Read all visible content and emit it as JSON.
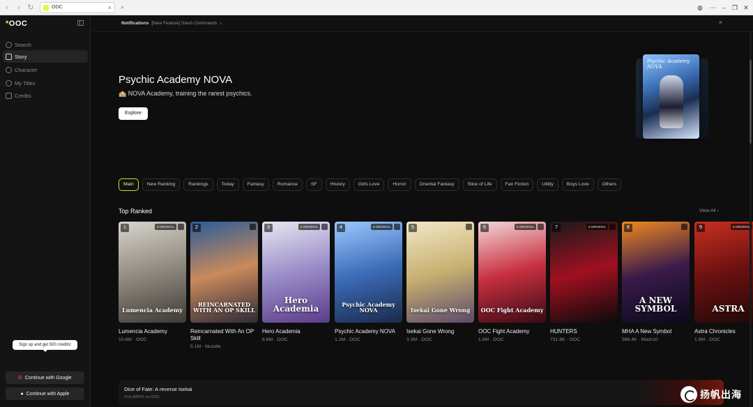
{
  "browser": {
    "tab_title": "OOC",
    "close": "×"
  },
  "sidebar": {
    "logo": "OOC",
    "items": [
      {
        "label": "Search",
        "icon": "search-icon"
      },
      {
        "label": "Story",
        "icon": "book-icon"
      },
      {
        "label": "Character",
        "icon": "character-icon"
      },
      {
        "label": "My Titles",
        "icon": "heart-icon"
      },
      {
        "label": "Credits",
        "icon": "credits-icon"
      }
    ],
    "signup_tip": "Sign up and get 500 credits!",
    "google_btn": "Continue with Google",
    "apple_btn": "Continue with Apple"
  },
  "notification": {
    "label": "Notifications",
    "message": "[New Feature] Slash Commands",
    "chevron": "›",
    "close": "×"
  },
  "hero": {
    "title": "Psychic Academy NOVA",
    "subtitle": "🏫 NOVA Academy, training the rarest psychics.",
    "explore": "Explore",
    "cover_title": "Psychic Academy NOVA"
  },
  "genres": [
    "Main",
    "New Ranking",
    "Rankings",
    "Today",
    "Fantasy",
    "Romance",
    "SF",
    "History",
    "Girls Love",
    "Horror",
    "Oriental Fantasy",
    "Slice of Life",
    "Fan Fiction",
    "Utility",
    "Boys Love",
    "Others"
  ],
  "top_ranked": {
    "title": "Top Ranked",
    "view_all": "View All ›",
    "badge": "ORIGINAL",
    "items": [
      {
        "rank": "1",
        "title": "Lumencia Academy",
        "meta": "10.6M · OOC",
        "cover_text": "Lumencia Academy",
        "original": true,
        "colors": [
          "#d9d4cc",
          "#8f8a80",
          "#3e3a34"
        ]
      },
      {
        "rank": "2",
        "title": "Reincarnated With An OP Skill",
        "meta": "5.1M · Nuzelle",
        "cover_text": "REINCARNATED WITH AN OP SKILL",
        "original": false,
        "colors": [
          "#2a5c9a",
          "#c98a5a",
          "#2e2a3a"
        ]
      },
      {
        "rank": "3",
        "title": "Hero Academia",
        "meta": "8.8M · OOC",
        "cover_text": "Hero Academia",
        "original": true,
        "colors": [
          "#e8e8f2",
          "#9a8cc8",
          "#5a3c8a"
        ]
      },
      {
        "rank": "4",
        "title": "Psychic Academy NOVA",
        "meta": "1.2M · OOC",
        "cover_text": "Psychic Academy NOVA",
        "original": true,
        "colors": [
          "#9dc8ff",
          "#3c6cb8",
          "#1a2a4a"
        ]
      },
      {
        "rank": "5",
        "title": "Isekai Gone Wrong",
        "meta": "3.3M · OOC",
        "cover_text": "Isekai Gone Wrong",
        "original": false,
        "colors": [
          "#f2e8c8",
          "#c8b070",
          "#5a4a6a"
        ]
      },
      {
        "rank": "6",
        "title": "OOC Fight Academy",
        "meta": "1.8M · OOC",
        "cover_text": "OOC Fight Academy",
        "original": true,
        "colors": [
          "#f2d8d8",
          "#c83040",
          "#3a0a14"
        ]
      },
      {
        "rank": "7",
        "title": "HUNTERS",
        "meta": "731.6K · OOC",
        "cover_text": "",
        "original": true,
        "colors": [
          "#1a1a1a",
          "#a01020",
          "#0a0a0a"
        ]
      },
      {
        "rank": "8",
        "title": "MHA A New Symbol",
        "meta": "566.4K · Mash10",
        "cover_text": "A NEW SYMBOL",
        "original": false,
        "colors": [
          "#f08a20",
          "#3a1a4a",
          "#0a0a1a"
        ]
      },
      {
        "rank": "9",
        "title": "Astra Chronicles",
        "meta": "1.9M · OOC",
        "cover_text": "ASTRA",
        "original": true,
        "colors": [
          "#c83020",
          "#6a1010",
          "#200808"
        ]
      }
    ]
  },
  "banner": {
    "title": "Dice of Fate: A reverse Isekai",
    "subtitle": "First AIRPG on OOC"
  },
  "watermark": "扬帆出海"
}
